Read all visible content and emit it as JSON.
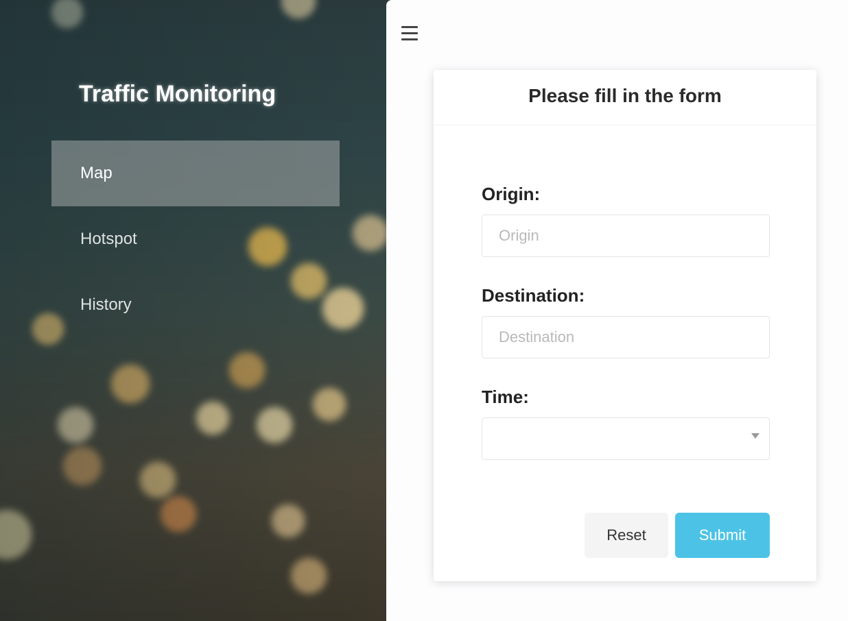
{
  "sidebar": {
    "title": "Traffic Monitoring",
    "items": [
      {
        "label": "Map",
        "active": true
      },
      {
        "label": "Hotspot",
        "active": false
      },
      {
        "label": "History",
        "active": false
      }
    ]
  },
  "header": {
    "menu_icon": "hamburger-menu-icon"
  },
  "form": {
    "title": "Please fill in the form",
    "origin": {
      "label": "Origin:",
      "placeholder": "Origin",
      "value": ""
    },
    "destination": {
      "label": "Destination:",
      "placeholder": "Destination",
      "value": ""
    },
    "time": {
      "label": "Time:",
      "value": ""
    },
    "reset_label": "Reset",
    "submit_label": "Submit"
  },
  "colors": {
    "submit_button": "#4cc3e6",
    "sidebar_active": "#bebebe"
  }
}
